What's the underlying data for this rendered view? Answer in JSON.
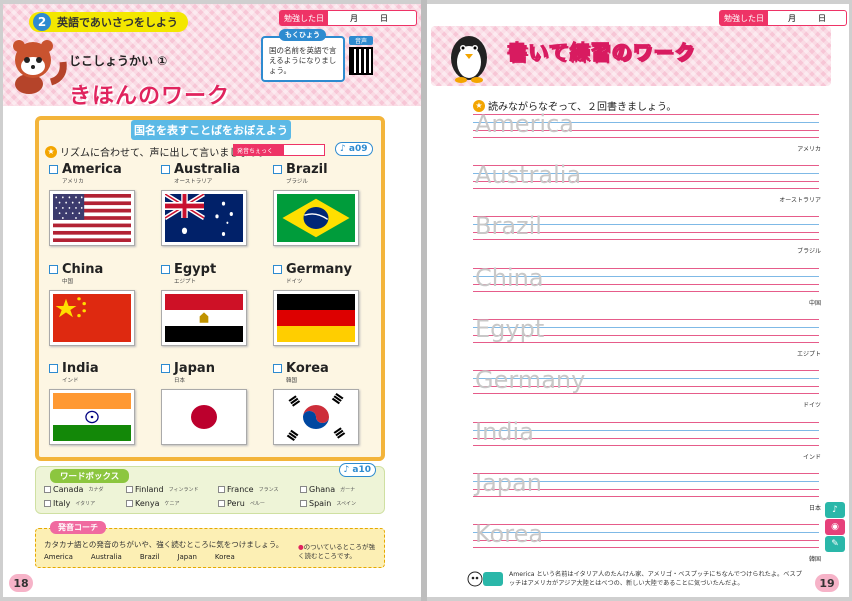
{
  "left": {
    "lesson_number": "2",
    "lesson_title": "英語であいさつをしよう",
    "subtitle": "じこしょうかい ①",
    "title": "きほんのワーク",
    "studied_label": "勉強した日",
    "month_label": "月",
    "day_label": "日",
    "mokuhyou_label": "もくひょう",
    "mokuhyou_text": "国の名前を英語で言えるようになりましょう。",
    "qr_label": "音声",
    "box_heading": "国名を表すことばをおぼえよう",
    "instruction": "リズムに合わせて、声に出して言いましょう。",
    "check_label": "発音ちぇっく",
    "audio_track": "a09",
    "countries": [
      {
        "name": "America",
        "kana": "アメリカ"
      },
      {
        "name": "Australia",
        "kana": "オーストラリア"
      },
      {
        "name": "Brazil",
        "kana": "ブラジル"
      },
      {
        "name": "China",
        "kana": "中国"
      },
      {
        "name": "Egypt",
        "kana": "エジプト"
      },
      {
        "name": "Germany",
        "kana": "ドイツ"
      },
      {
        "name": "India",
        "kana": "インド"
      },
      {
        "name": "Japan",
        "kana": "日本"
      },
      {
        "name": "Korea",
        "kana": "韓国"
      }
    ],
    "wordbox_label": "ワードボックス",
    "wordbox_audio": "a10",
    "wordbox_items": [
      {
        "en": "Canada",
        "jp": "カナダ"
      },
      {
        "en": "Finland",
        "jp": "フィンランド"
      },
      {
        "en": "France",
        "jp": "フランス"
      },
      {
        "en": "Ghana",
        "jp": "ガーナ"
      },
      {
        "en": "Italy",
        "jp": "イタリア"
      },
      {
        "en": "Kenya",
        "jp": "ケニア"
      },
      {
        "en": "Peru",
        "jp": "ペルー"
      },
      {
        "en": "Spain",
        "jp": "スペイン"
      }
    ],
    "pron_label": "発音コーチ",
    "pron_text": "カタカナ語との発音のちがいや、強く読むところに気をつけましょう。",
    "pron_words": [
      "America",
      "Australia",
      "Brazil",
      "Japan",
      "Korea"
    ],
    "pron_note": "のついているところが強く読むところです。",
    "page_number": "18"
  },
  "right": {
    "studied_label": "勉強した日",
    "month_label": "月",
    "day_label": "日",
    "title": "書いて練習のワーク",
    "instruction": "読みながらなぞって、２回書きましょう。",
    "rows": [
      {
        "en": "America",
        "jp": "アメリカ"
      },
      {
        "en": "Australia",
        "jp": "オーストラリア"
      },
      {
        "en": "Brazil",
        "jp": "ブラジル"
      },
      {
        "en": "China",
        "jp": "中国"
      },
      {
        "en": "Egypt",
        "jp": "エジプト"
      },
      {
        "en": "Germany",
        "jp": "ドイツ"
      },
      {
        "en": "India",
        "jp": "インド"
      },
      {
        "en": "Japan",
        "jp": "日本"
      },
      {
        "en": "Korea",
        "jp": "韓国"
      }
    ],
    "footnote": "America という名前はイタリア人のたんけん家、アメリゴ・ベスプッチにちなんでつけられたよ。ベスプッチはアメリカがアジア大陸とはべつの、新しい大陸であることに気づいたんだよ。",
    "page_number": "19"
  },
  "colors": {
    "accent_pink": "#e0245e",
    "box_orange": "#f3b43a",
    "heading_blue": "#5bb9e6",
    "word_green": "#8cc63f"
  }
}
